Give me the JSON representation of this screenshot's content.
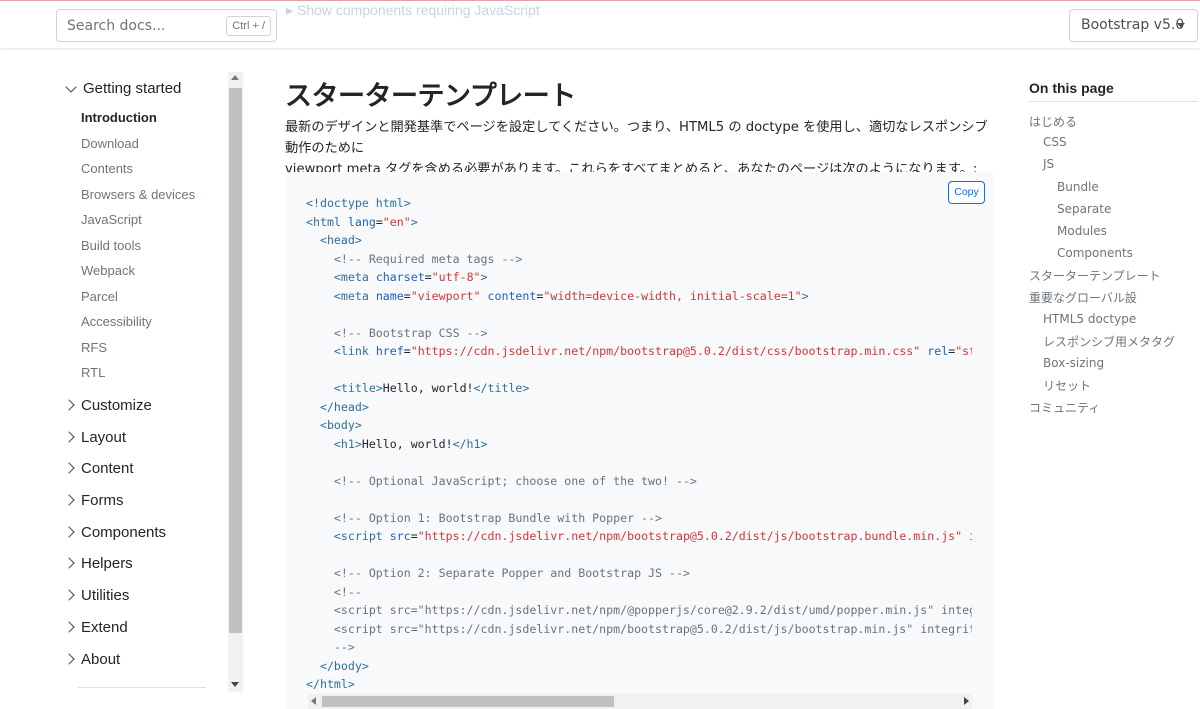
{
  "header": {
    "ghost_text": "▸ Show components requiring JavaScript",
    "search_placeholder": "Search docs...",
    "search_shortcut": "Ctrl + /",
    "version_label": "Bootstrap v5.0"
  },
  "sidebar": {
    "open_group": "Getting started",
    "sub_items": [
      "Introduction",
      "Download",
      "Contents",
      "Browsers & devices",
      "JavaScript",
      "Build tools",
      "Webpack",
      "Parcel",
      "Accessibility",
      "RFS",
      "RTL"
    ],
    "groups": [
      "Customize",
      "Layout",
      "Content",
      "Forms",
      "Components",
      "Helpers",
      "Utilities",
      "Extend",
      "About"
    ]
  },
  "main": {
    "title": "スターターテンプレート",
    "intro_line1": "最新のデザインと開発基準でページを設定してください。つまり、HTML5 の doctype を使用し、適切なレスポンシブ動作のために",
    "intro_line2": "viewport meta タグを含める必要があります。これらをすべてまとめると、あなたのページは次のようになります。:",
    "copy_label": "Copy"
  },
  "code_lines": [
    [
      [
        "doc",
        "<!doctype html>"
      ]
    ],
    [
      [
        "tag",
        "<html "
      ],
      [
        "attr",
        "lang"
      ],
      [
        "txt",
        "="
      ],
      [
        "str",
        "\"en\""
      ],
      [
        "tag",
        ">"
      ]
    ],
    [
      [
        "txt",
        "  "
      ],
      [
        "tag",
        "<head>"
      ]
    ],
    [
      [
        "txt",
        "    "
      ],
      [
        "com",
        "<!-- Required meta tags -->"
      ]
    ],
    [
      [
        "txt",
        "    "
      ],
      [
        "tag",
        "<meta "
      ],
      [
        "attr",
        "charset"
      ],
      [
        "txt",
        "="
      ],
      [
        "str",
        "\"utf-8\""
      ],
      [
        "tag",
        ">"
      ]
    ],
    [
      [
        "txt",
        "    "
      ],
      [
        "tag",
        "<meta "
      ],
      [
        "attr",
        "name"
      ],
      [
        "txt",
        "="
      ],
      [
        "str",
        "\"viewport\""
      ],
      [
        "txt",
        " "
      ],
      [
        "attr",
        "content"
      ],
      [
        "txt",
        "="
      ],
      [
        "str",
        "\"width=device-width, initial-scale=1\""
      ],
      [
        "tag",
        ">"
      ]
    ],
    [
      [
        "txt",
        ""
      ]
    ],
    [
      [
        "txt",
        "    "
      ],
      [
        "com",
        "<!-- Bootstrap CSS -->"
      ]
    ],
    [
      [
        "txt",
        "    "
      ],
      [
        "tag",
        "<link "
      ],
      [
        "attr",
        "href"
      ],
      [
        "txt",
        "="
      ],
      [
        "str",
        "\"https://cdn.jsdelivr.net/npm/bootstrap@5.0.2/dist/css/bootstrap.min.css\""
      ],
      [
        "txt",
        " "
      ],
      [
        "attr",
        "rel"
      ],
      [
        "txt",
        "="
      ],
      [
        "str",
        "\"stylesheet\""
      ]
    ],
    [
      [
        "txt",
        ""
      ]
    ],
    [
      [
        "txt",
        "    "
      ],
      [
        "tag",
        "<title>"
      ],
      [
        "txt",
        "Hello, world!"
      ],
      [
        "tag",
        "</title>"
      ]
    ],
    [
      [
        "txt",
        "  "
      ],
      [
        "tag",
        "</head>"
      ]
    ],
    [
      [
        "txt",
        "  "
      ],
      [
        "tag",
        "<body>"
      ]
    ],
    [
      [
        "txt",
        "    "
      ],
      [
        "tag",
        "<h1>"
      ],
      [
        "txt",
        "Hello, world!"
      ],
      [
        "tag",
        "</h1>"
      ]
    ],
    [
      [
        "txt",
        ""
      ]
    ],
    [
      [
        "txt",
        "    "
      ],
      [
        "com",
        "<!-- Optional JavaScript; choose one of the two! -->"
      ]
    ],
    [
      [
        "txt",
        ""
      ]
    ],
    [
      [
        "txt",
        "    "
      ],
      [
        "com",
        "<!-- Option 1: Bootstrap Bundle with Popper -->"
      ]
    ],
    [
      [
        "txt",
        "    "
      ],
      [
        "tag",
        "<script "
      ],
      [
        "attr",
        "src"
      ],
      [
        "txt",
        "="
      ],
      [
        "str",
        "\"https://cdn.jsdelivr.net/npm/bootstrap@5.0.2/dist/js/bootstrap.bundle.min.js\""
      ],
      [
        "txt",
        " "
      ],
      [
        "attr",
        "integrity"
      ]
    ],
    [
      [
        "txt",
        ""
      ]
    ],
    [
      [
        "txt",
        "    "
      ],
      [
        "com",
        "<!-- Option 2: Separate Popper and Bootstrap JS -->"
      ]
    ],
    [
      [
        "txt",
        "    "
      ],
      [
        "com",
        "<!--"
      ]
    ],
    [
      [
        "txt",
        "    "
      ],
      [
        "com",
        "<script src=\"https://cdn.jsdelivr.net/npm/@popperjs/core@2.9.2/dist/umd/popper.min.js\" integrity"
      ]
    ],
    [
      [
        "txt",
        "    "
      ],
      [
        "com",
        "<script src=\"https://cdn.jsdelivr.net/npm/bootstrap@5.0.2/dist/js/bootstrap.min.js\" integrity=\""
      ]
    ],
    [
      [
        "txt",
        "    "
      ],
      [
        "com",
        "-->"
      ]
    ],
    [
      [
        "txt",
        "  "
      ],
      [
        "tag",
        "</body>"
      ]
    ],
    [
      [
        "tag",
        "</html>"
      ]
    ]
  ],
  "toc": {
    "heading": "On this page",
    "items": [
      {
        "label": "はじめる",
        "level": 0
      },
      {
        "label": "CSS",
        "level": 1
      },
      {
        "label": "JS",
        "level": 1
      },
      {
        "label": "Bundle",
        "level": 2
      },
      {
        "label": "Separate",
        "level": 2
      },
      {
        "label": "Modules",
        "level": 2
      },
      {
        "label": "Components",
        "level": 2
      },
      {
        "label": "スターターテンプレート",
        "level": 0
      },
      {
        "label": "重要なグローバル設",
        "level": 0
      },
      {
        "label": "HTML5 doctype",
        "level": 1
      },
      {
        "label": "レスポンシブ用メタタグ",
        "level": 1
      },
      {
        "label": "Box-sizing",
        "level": 1
      },
      {
        "label": "リセット",
        "level": 1
      },
      {
        "label": "コミュニティ",
        "level": 0
      }
    ]
  },
  "colors": {
    "accent": "#0d6efd",
    "code_tag": "#2f6f9f",
    "code_attr": "#1f5fbf",
    "code_string": "#d3363b",
    "code_comment": "#6a737d"
  }
}
